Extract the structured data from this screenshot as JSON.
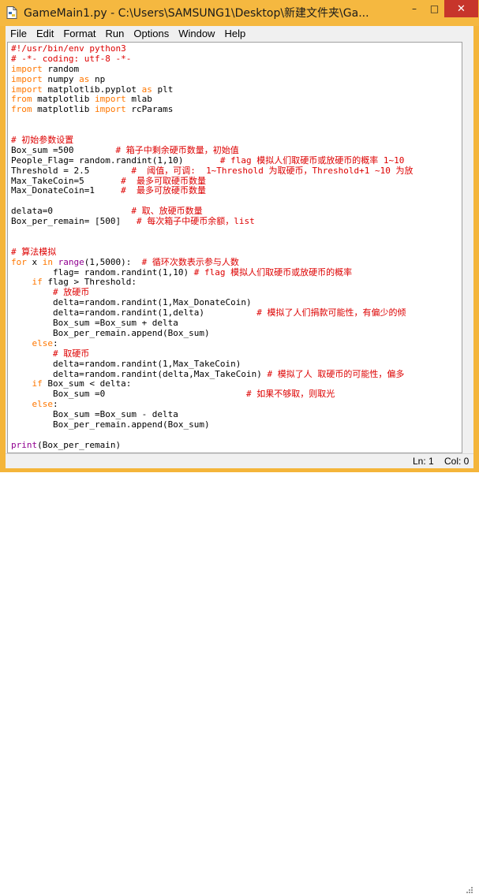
{
  "window": {
    "title": "GameMain1.py - C:\\Users\\SAMSUNG1\\Desktop\\新建文件夹\\Ga...",
    "minimize_glyph": "–",
    "maximize_glyph": "□",
    "close_glyph": "✕",
    "accent_color": "#f5b840",
    "close_color": "#c7352b"
  },
  "menu": {
    "items": [
      "File",
      "Edit",
      "Format",
      "Run",
      "Options",
      "Window",
      "Help"
    ]
  },
  "editor": {
    "lines": [
      [
        {
          "t": "#!/usr/bin/env python3",
          "c": "cm"
        }
      ],
      [
        {
          "t": "# -*- coding: utf-8 -*-",
          "c": "cm"
        }
      ],
      [
        {
          "t": "import",
          "c": "kw"
        },
        {
          "t": " random",
          "c": ""
        }
      ],
      [
        {
          "t": "import",
          "c": "kw"
        },
        {
          "t": " numpy ",
          "c": ""
        },
        {
          "t": "as",
          "c": "kw"
        },
        {
          "t": " np",
          "c": ""
        }
      ],
      [
        {
          "t": "import",
          "c": "kw"
        },
        {
          "t": " matplotlib.pyplot ",
          "c": ""
        },
        {
          "t": "as",
          "c": "kw"
        },
        {
          "t": " plt",
          "c": ""
        }
      ],
      [
        {
          "t": "from",
          "c": "kw"
        },
        {
          "t": " matplotlib ",
          "c": ""
        },
        {
          "t": "import",
          "c": "kw"
        },
        {
          "t": " mlab",
          "c": ""
        }
      ],
      [
        {
          "t": "from",
          "c": "kw"
        },
        {
          "t": " matplotlib ",
          "c": ""
        },
        {
          "t": "import",
          "c": "kw"
        },
        {
          "t": " rcParams",
          "c": ""
        }
      ],
      [],
      [],
      [
        {
          "t": "# 初始参数设置",
          "c": "cm"
        }
      ],
      [
        {
          "t": "Box_sum =500        ",
          "c": ""
        },
        {
          "t": "# 箱子中剩余硬币数量，初始值",
          "c": "cm"
        }
      ],
      [
        {
          "t": "People_Flag= random.randint(1,10)       ",
          "c": ""
        },
        {
          "t": "# flag 模拟人们取硬币或放硬币的概率 1~10",
          "c": "cm"
        }
      ],
      [
        {
          "t": "Threshold = 2.5        ",
          "c": ""
        },
        {
          "t": "#  阈值，可调:  1~Threshold 为取硬币，Threshold+1 ~10 为放",
          "c": "cm"
        }
      ],
      [
        {
          "t": "Max_TakeCoin=5       ",
          "c": ""
        },
        {
          "t": "#  最多可取硬币数量",
          "c": "cm"
        }
      ],
      [
        {
          "t": "Max_DonateCoin=1     ",
          "c": ""
        },
        {
          "t": "#  最多可放硬币数量",
          "c": "cm"
        }
      ],
      [],
      [
        {
          "t": "delata=0               ",
          "c": ""
        },
        {
          "t": "# 取、放硬币数量",
          "c": "cm"
        }
      ],
      [
        {
          "t": "Box_per_remain= [500]   ",
          "c": ""
        },
        {
          "t": "# 每次箱子中硬币余额，list",
          "c": "cm"
        }
      ],
      [],
      [],
      [
        {
          "t": "# 算法模拟",
          "c": "cm"
        }
      ],
      [
        {
          "t": "for",
          "c": "kw"
        },
        {
          "t": " x ",
          "c": ""
        },
        {
          "t": "in",
          "c": "kw"
        },
        {
          "t": " ",
          "c": ""
        },
        {
          "t": "range",
          "c": "bi"
        },
        {
          "t": "(1,5000):  ",
          "c": ""
        },
        {
          "t": "# 循环次数表示参与人数",
          "c": "cm"
        }
      ],
      [
        {
          "t": "        flag= random.randint(1,10) ",
          "c": ""
        },
        {
          "t": "# flag 模拟人们取硬币或放硬币的概率",
          "c": "cm"
        }
      ],
      [
        {
          "t": "    ",
          "c": ""
        },
        {
          "t": "if",
          "c": "kw"
        },
        {
          "t": " flag > Threshold:",
          "c": ""
        }
      ],
      [
        {
          "t": "        ",
          "c": ""
        },
        {
          "t": "# 放硬币",
          "c": "cm"
        }
      ],
      [
        {
          "t": "        delta=random.randint(1,Max_DonateCoin)",
          "c": ""
        }
      ],
      [
        {
          "t": "        delta=random.randint(1,delta)          ",
          "c": ""
        },
        {
          "t": "# 模拟了人们捐款可能性，有偏少的倾",
          "c": "cm"
        }
      ],
      [
        {
          "t": "        Box_sum =Box_sum + delta",
          "c": ""
        }
      ],
      [
        {
          "t": "        Box_per_remain.append(Box_sum)",
          "c": ""
        }
      ],
      [
        {
          "t": "    ",
          "c": ""
        },
        {
          "t": "else",
          "c": "kw"
        },
        {
          "t": ":",
          "c": ""
        }
      ],
      [
        {
          "t": "        ",
          "c": ""
        },
        {
          "t": "# 取硬币",
          "c": "cm"
        }
      ],
      [
        {
          "t": "        delta=random.randint(1,Max_TakeCoin)",
          "c": ""
        }
      ],
      [
        {
          "t": "        delta=random.randint(delta,Max_TakeCoin) ",
          "c": ""
        },
        {
          "t": "# 模拟了人 取硬币的可能性，偏多",
          "c": "cm"
        }
      ],
      [
        {
          "t": "    ",
          "c": ""
        },
        {
          "t": "if",
          "c": "kw"
        },
        {
          "t": " Box_sum < delta:",
          "c": ""
        }
      ],
      [
        {
          "t": "        Box_sum =0                           ",
          "c": ""
        },
        {
          "t": "# 如果不够取，则取光",
          "c": "cm"
        }
      ],
      [
        {
          "t": "    ",
          "c": ""
        },
        {
          "t": "else",
          "c": "kw"
        },
        {
          "t": ":",
          "c": ""
        }
      ],
      [
        {
          "t": "        Box_sum =Box_sum - delta",
          "c": ""
        }
      ],
      [
        {
          "t": "        Box_per_remain.append(Box_sum)",
          "c": ""
        }
      ],
      [],
      [
        {
          "t": "print",
          "c": "bi"
        },
        {
          "t": "(Box_per_remain)",
          "c": ""
        }
      ]
    ]
  },
  "status": {
    "line": "Ln: 1",
    "col": "Col: 0"
  }
}
